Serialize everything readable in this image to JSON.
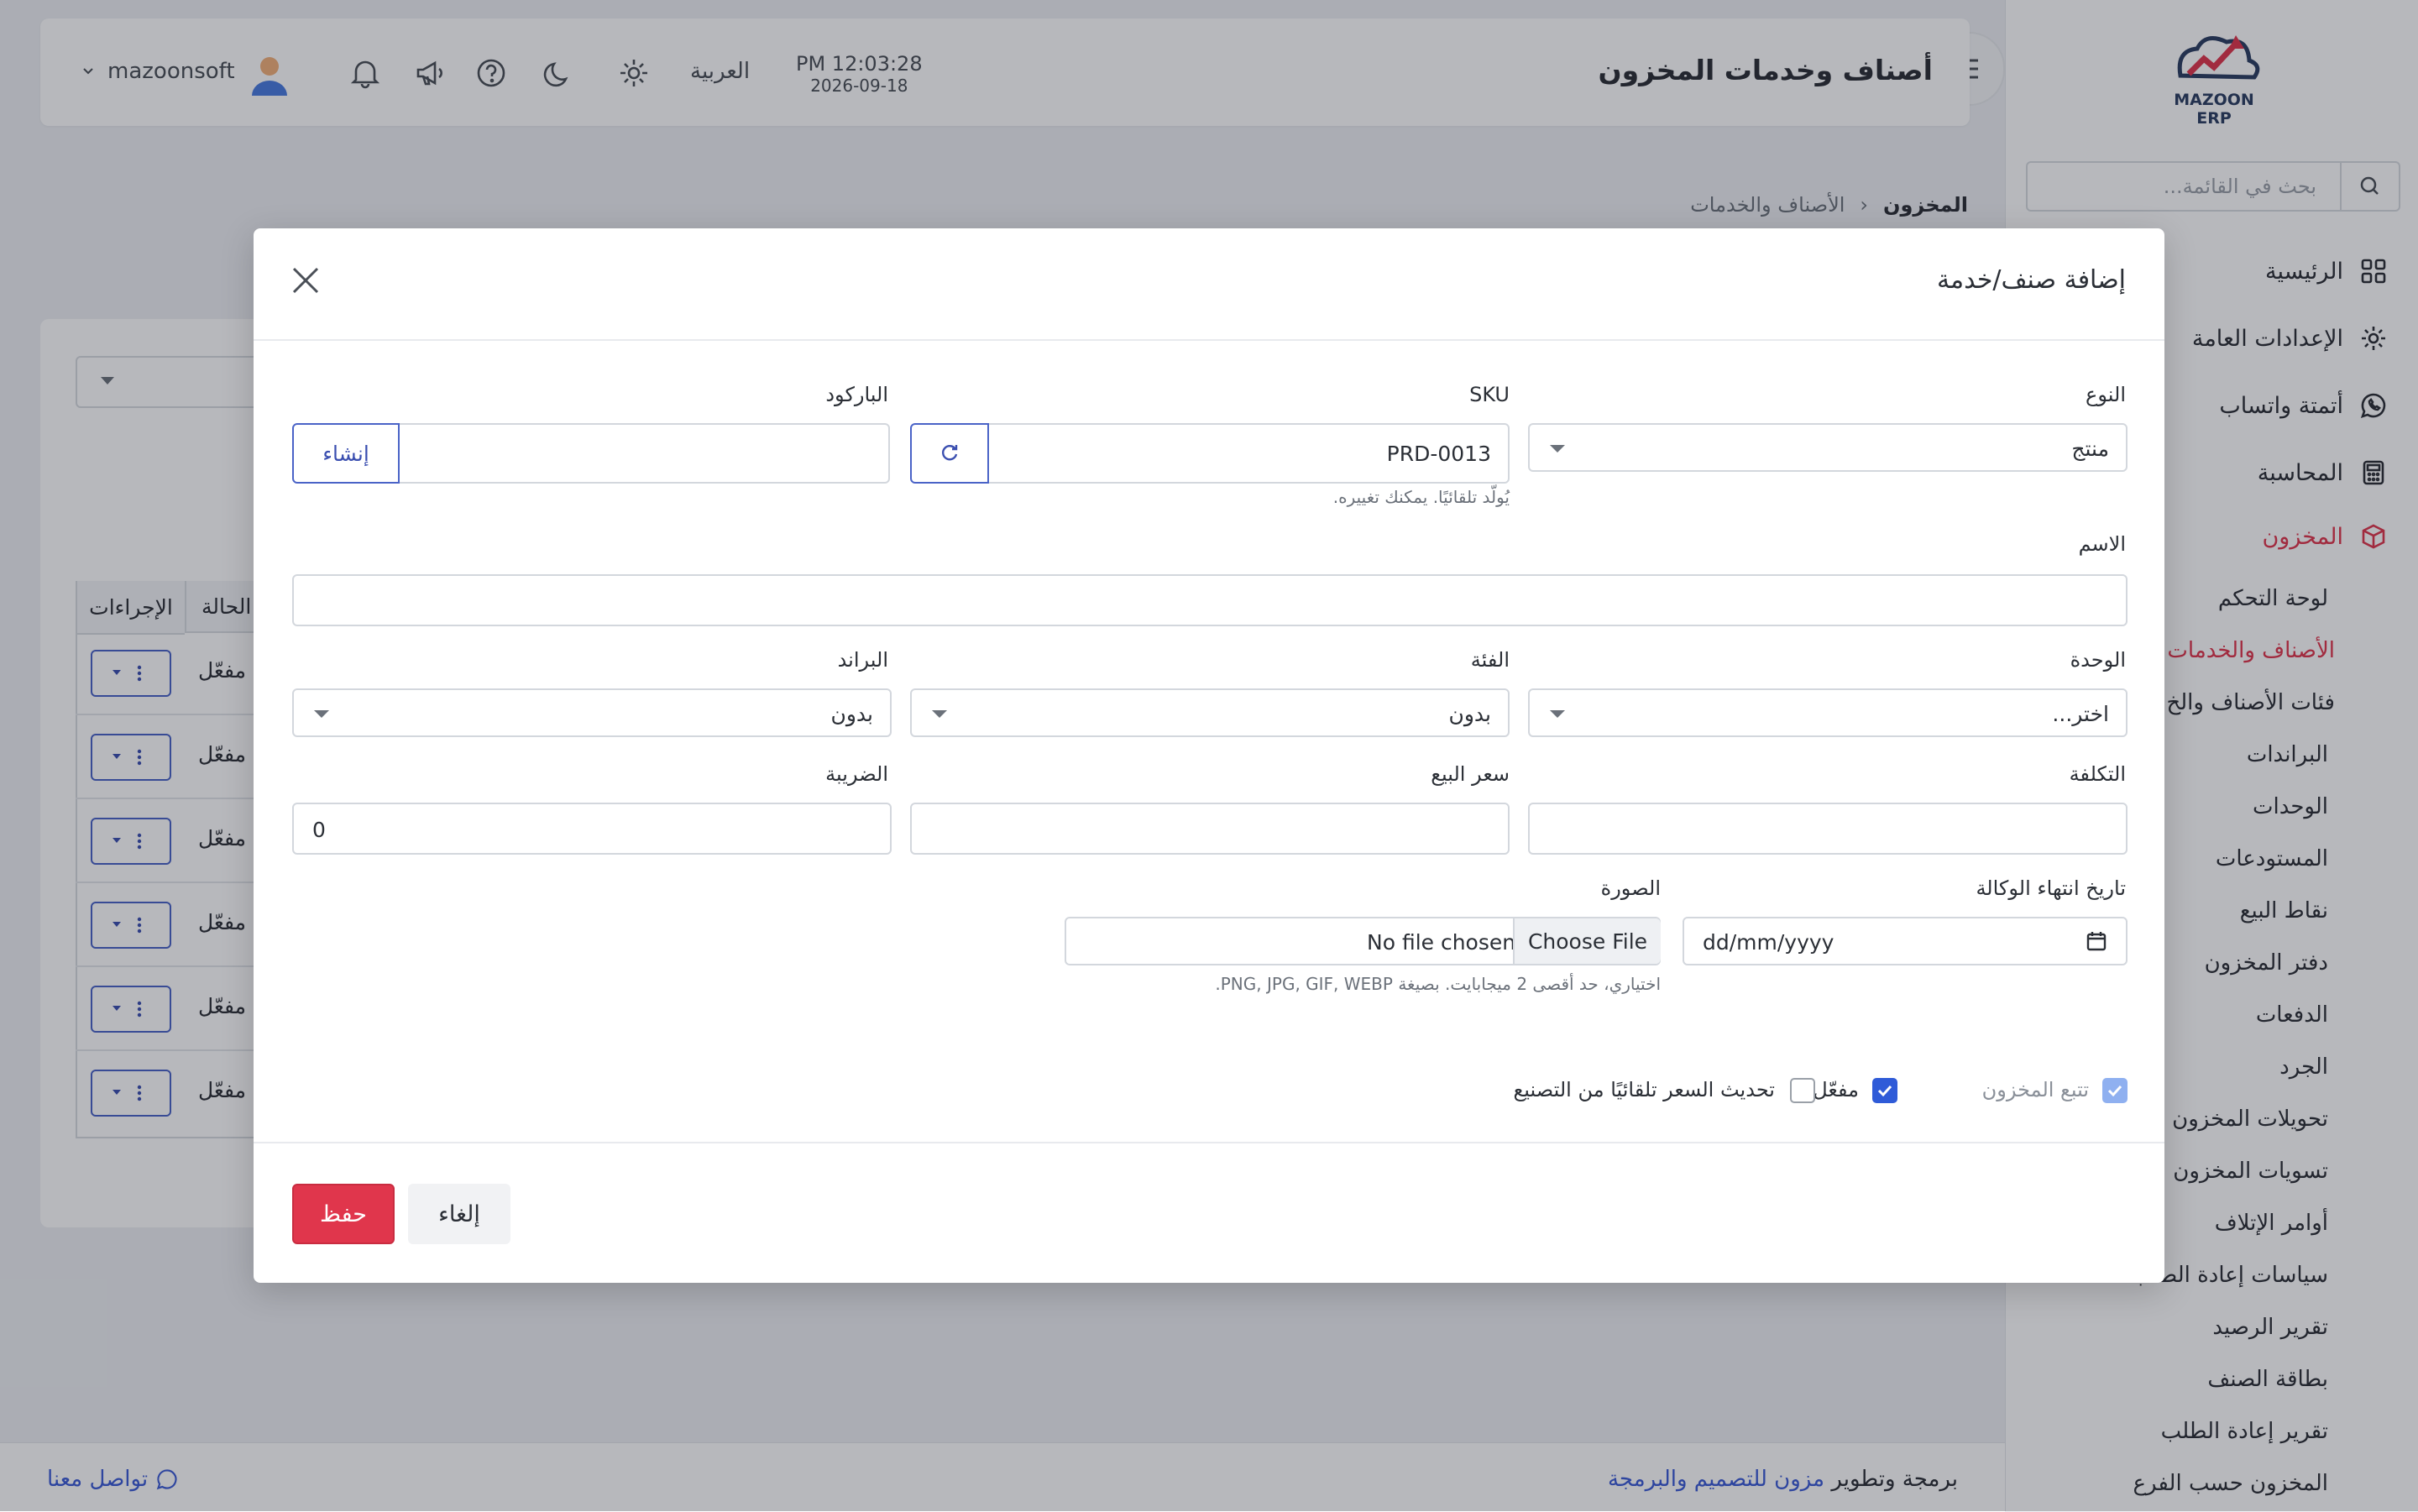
{
  "sidebar": {
    "logo_text": "MAZOON ERP",
    "search_placeholder": "بحث في القائمة...",
    "nav": [
      {
        "label": "الرئيسية",
        "icon": "grid-icon"
      },
      {
        "label": "الإعدادات العامة",
        "icon": "gear-icon"
      },
      {
        "label": "أتمتة واتساب",
        "icon": "whatsapp-icon"
      },
      {
        "label": "المحاسبة",
        "icon": "calculator-icon"
      },
      {
        "label": "المخزون",
        "icon": "box-icon"
      }
    ],
    "sub_items": [
      "لوحة التحكم",
      "الأصناف والخدمات",
      "فئات الأصناف والخ",
      "البراندات",
      "الوحدات",
      "المستودعات",
      "نقاط البيع",
      "دفتر المخزون",
      "الدفعات",
      "الجرد",
      "تحويلات المخزون",
      "تسويات المخزون",
      "أوامر الإتلاف",
      "سياسات إعادة الطلب",
      "تقرير الرصيد",
      "بطاقة الصنف",
      "تقرير إعادة الطلب",
      "المخزون حسب الفرع"
    ]
  },
  "topbar": {
    "page_title": "أصناف وخدمات المخزون",
    "time": "PM 12:03:28",
    "date": "2026-09-18",
    "language": "العربية",
    "username": "mazoonsoft"
  },
  "breadcrumb": {
    "root": "المخزون",
    "separator": "‹",
    "current": "الأصناف والخدمات"
  },
  "table": {
    "headers": {
      "actions": "الإجراءات",
      "status": "الحالة"
    },
    "rows": [
      {
        "status": "مفعّل"
      },
      {
        "status": "مفعّل"
      },
      {
        "status": "مفعّل"
      },
      {
        "status": "مفعّل"
      },
      {
        "status": "مفعّل"
      },
      {
        "status": "مفعّل"
      }
    ]
  },
  "footer": {
    "credit_prefix": "برمجة وتطوير",
    "credit_link": "مزون للتصميم والبرمجة",
    "contact": "تواصل معنا"
  },
  "modal": {
    "title": "إضافة صنف/خدمة",
    "type": {
      "label": "النوع",
      "value": "منتج"
    },
    "sku": {
      "label": "SKU",
      "value": "PRD-0013",
      "hint": "يُولّد تلقائيًا. يمكنك تغييره."
    },
    "barcode": {
      "label": "الباركود",
      "value": "",
      "generate_label": "إنشاء"
    },
    "name": {
      "label": "الاسم",
      "value": ""
    },
    "unit": {
      "label": "الوحدة",
      "value": "اختر..."
    },
    "category": {
      "label": "الفئة",
      "value": "بدون"
    },
    "brand": {
      "label": "البراند",
      "value": "بدون"
    },
    "cost": {
      "label": "التكلفة",
      "value": ""
    },
    "sale_price": {
      "label": "سعر البيع",
      "value": ""
    },
    "tax": {
      "label": "الضريبة",
      "value": "0"
    },
    "warranty": {
      "label": "تاريخ انتهاء الوكالة",
      "placeholder": "dd/mm/yyyy"
    },
    "image": {
      "label": "الصورة",
      "button": "Choose File",
      "status": "No file chosen",
      "hint": "اختياري، حد أقصى 2 ميجابايت. بصيغة PNG, JPG, GIF, WEBP."
    },
    "track_stock": {
      "label": "تتبع المخزون",
      "checked": true
    },
    "active": {
      "label": "مفعّل",
      "checked": true
    },
    "auto_price": {
      "label": "تحديث السعر تلقائيًا من التصنيع",
      "checked": false
    },
    "save_label": "حفظ",
    "cancel_label": "إلغاء"
  },
  "colors": {
    "accent": "#e0364c",
    "primary": "#2f5bd8",
    "outline": "#4a63c7"
  }
}
